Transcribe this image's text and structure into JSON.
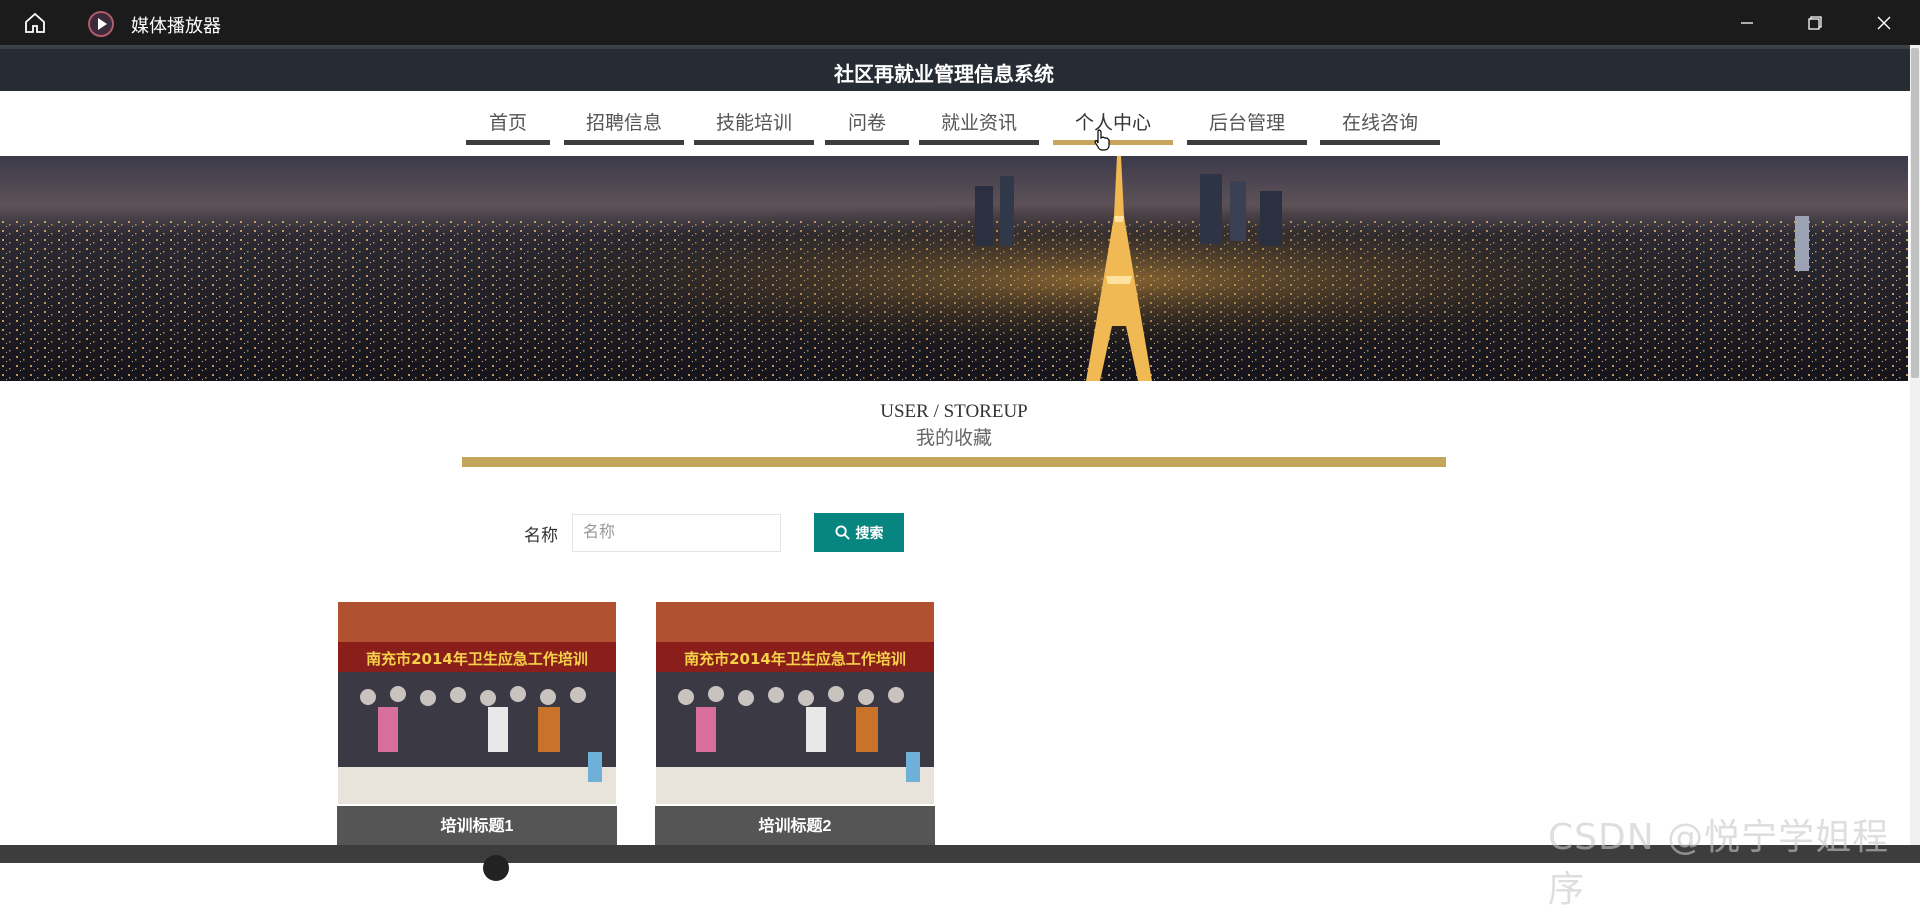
{
  "window": {
    "title": "媒体播放器"
  },
  "site": {
    "title": "社区再就业管理信息系统"
  },
  "nav": {
    "items": [
      {
        "label": "首页"
      },
      {
        "label": "招聘信息"
      },
      {
        "label": "技能培训"
      },
      {
        "label": "问卷"
      },
      {
        "label": "就业资讯"
      },
      {
        "label": "个人中心",
        "active": true
      },
      {
        "label": "后台管理"
      },
      {
        "label": "在线咨询"
      }
    ]
  },
  "section": {
    "title_en": "USER / STOREUP",
    "title_zh": "我的收藏"
  },
  "search": {
    "label": "名称",
    "placeholder": "名称",
    "value": "",
    "button_label": "搜索"
  },
  "cards": [
    {
      "caption": "培训标题1",
      "image_banner": "南充市2014年卫生应急工作培训"
    },
    {
      "caption": "培训标题2",
      "image_banner": "南充市2014年卫生应急工作培训"
    }
  ],
  "watermark": "CSDN @悦宁学姐程序",
  "colors": {
    "accent_gold": "#c4a55c",
    "search_button": "#07857f",
    "header_bg": "#252c33",
    "nav_bar": "#3e3e3e",
    "card_caption_bg": "#555555"
  }
}
